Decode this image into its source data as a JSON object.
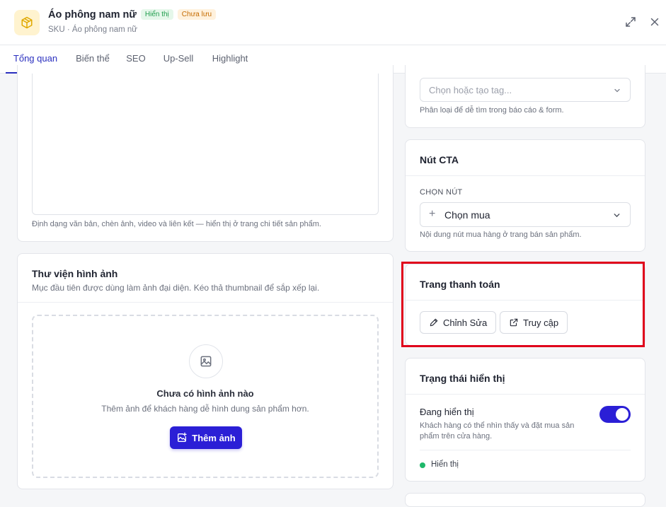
{
  "header": {
    "title": "Áo phông nam nữ",
    "badge_visible": "Hiển thị",
    "badge_unsaved": "Chưa lưu",
    "subtitle": "SKU · Áo phông nam nữ",
    "logo_icon": "package-icon",
    "expand_icon": "expand-icon",
    "close_icon": "close-icon"
  },
  "tabs": [
    {
      "label": "Tổng quan",
      "active": true
    },
    {
      "label": "Biến thể",
      "active": false
    },
    {
      "label": "SEO",
      "active": false
    },
    {
      "label": "Up-Sell",
      "active": false
    },
    {
      "label": "Highlight",
      "active": false
    }
  ],
  "description": {
    "hint": "Định dạng văn bản, chèn ảnh, video và liên kết — hiển thị ở trang chi tiết sản phẩm."
  },
  "gallery": {
    "title": "Thư viện hình ảnh",
    "subtitle": "Mục đầu tiên được dùng làm ảnh đại diện. Kéo thả thumbnail để sắp xếp lại.",
    "empty_title": "Chưa có hình ảnh nào",
    "empty_text": "Thêm ảnh để khách hàng dễ hình dung sản phẩm hơn.",
    "add_button": "Thêm ảnh"
  },
  "tags": {
    "placeholder": "Chọn hoặc tạo tag...",
    "hint": "Phân loại để dễ tìm trong báo cáo & form."
  },
  "cta": {
    "title": "Nút CTA",
    "field_label": "CHỌN NÚT",
    "selected": "Chọn mua",
    "hint": "Nội dung nút mua hàng ở trang bán sản phẩm."
  },
  "checkout": {
    "title": "Trang thanh toán",
    "edit_button": "Chỉnh Sửa",
    "visit_button": "Truy cập"
  },
  "visibility": {
    "title": "Trạng thái hiển thị",
    "toggle_label": "Đang hiển thị",
    "toggle_desc": "Khách hàng có thể nhìn thấy và đặt mua sản phẩm trên cửa hàng.",
    "toggle_on": true,
    "status": "Hiển thị"
  },
  "colors": {
    "accent": "#2b1fd6",
    "active_tab": "#2a2fbf",
    "status_green": "#1fb86a",
    "highlight_red": "#e0001b",
    "logo_bg": "#fff3cf"
  }
}
